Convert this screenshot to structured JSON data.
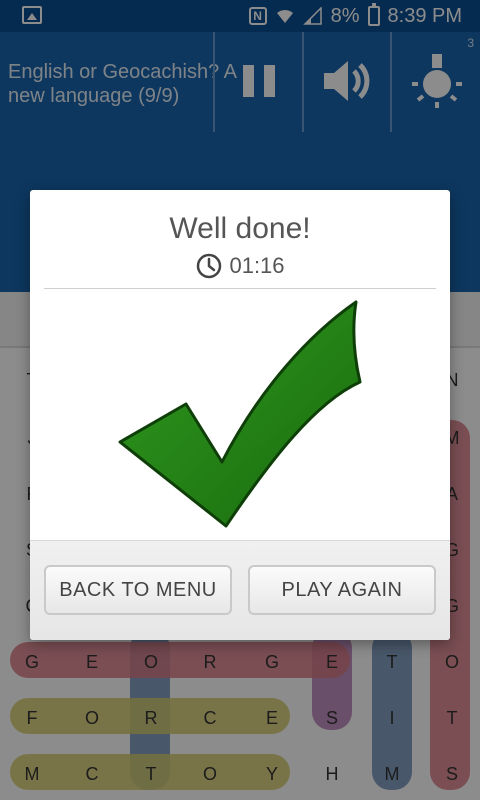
{
  "status_bar": {
    "nfc_label": "N",
    "battery_text": "8%",
    "time": "8:39 PM",
    "icons": [
      "image-notification-icon",
      "nfc-icon",
      "wifi-icon",
      "signal-icon",
      "battery-icon"
    ]
  },
  "header": {
    "puzzle_title": "English or Geocachish? A new language (9/9)",
    "hint_count": "3",
    "buttons": [
      "pause-button",
      "sound-button",
      "hint-button"
    ],
    "colors": {
      "status_bar": "#0c4f93",
      "header": "#1865ad"
    }
  },
  "grid": {
    "rows": [
      [
        "T",
        "",
        "",
        "",
        "",
        "",
        "",
        "",
        "",
        "",
        "N"
      ],
      [
        "J",
        "",
        "",
        "",
        "",
        "",
        "",
        "",
        "",
        "",
        "M"
      ],
      [
        "F",
        "",
        "",
        "",
        "",
        "",
        "",
        "",
        "",
        "",
        "A"
      ],
      [
        "S",
        "",
        "",
        "",
        "",
        "",
        "",
        "",
        "",
        "",
        "G"
      ],
      [
        "C",
        "",
        "",
        "",
        "",
        "",
        "",
        "",
        "",
        "",
        "G"
      ],
      [
        "G",
        "E",
        "O",
        "R",
        "G",
        "E",
        "T",
        "O"
      ],
      [
        "F",
        "O",
        "R",
        "C",
        "E",
        "S",
        "I",
        "T"
      ],
      [
        "M",
        "C",
        "T",
        "O",
        "Y",
        "H",
        "M",
        "S"
      ]
    ]
  },
  "dialog": {
    "title": "Well done!",
    "timer": "01:16",
    "back_button_label": "BACK TO MENU",
    "play_again_button_label": "PLAY AGAIN",
    "check_color": "#1e7a12"
  }
}
